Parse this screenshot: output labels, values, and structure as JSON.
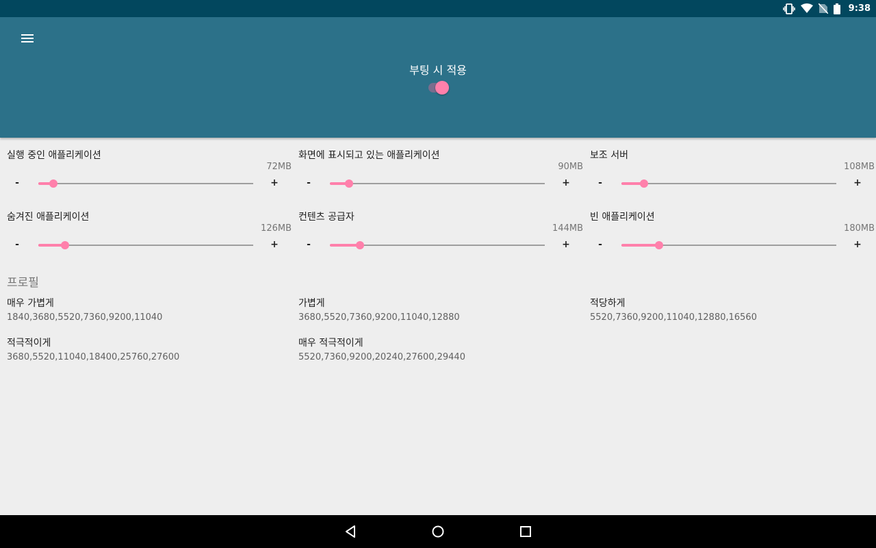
{
  "status_bar": {
    "time": "9:38",
    "icons": [
      "vibrate-icon",
      "wifi-icon",
      "no-sim-icon",
      "battery-icon"
    ]
  },
  "header": {
    "menu_icon": "hamburger-menu-icon",
    "boot_label": "부팅 시 적용",
    "boot_switch_on": true
  },
  "sliders": [
    {
      "label": "실행 중인 애플리케이션",
      "value": "72MB",
      "fraction": 0.07,
      "minus": "-",
      "plus": "+"
    },
    {
      "label": "화면에 표시되고 있는 애플리케이션",
      "value": "90MB",
      "fraction": 0.09,
      "minus": "-",
      "plus": "+"
    },
    {
      "label": "보조 서버",
      "value": "108MB",
      "fraction": 0.105,
      "minus": "-",
      "plus": "+"
    },
    {
      "label": "숨겨진 애플리케이션",
      "value": "126MB",
      "fraction": 0.125,
      "minus": "-",
      "plus": "+"
    },
    {
      "label": "컨텐츠 공급자",
      "value": "144MB",
      "fraction": 0.14,
      "minus": "-",
      "plus": "+"
    },
    {
      "label": "빈 애플리케이션",
      "value": "180MB",
      "fraction": 0.175,
      "minus": "-",
      "plus": "+"
    }
  ],
  "profiles": {
    "title": "프로필",
    "items": [
      {
        "name": "매우 가볍게",
        "values": "1840,3680,5520,7360,9200,11040"
      },
      {
        "name": "가볍게",
        "values": "3680,5520,7360,9200,11040,12880"
      },
      {
        "name": "적당하게",
        "values": "5520,7360,9200,11040,12880,16560"
      },
      {
        "name": "적극적이게",
        "values": "3680,5520,11040,18400,25760,27600"
      },
      {
        "name": "매우 적극적이게",
        "values": "5520,7360,9200,20240,27600,29440"
      }
    ]
  },
  "nav_bar": {
    "icons": [
      "back-icon",
      "home-icon",
      "recents-icon"
    ]
  },
  "colors": {
    "status_bar": "#02475e",
    "header": "#2c7189",
    "accent": "#ff80ab",
    "background": "#eeeeee"
  }
}
